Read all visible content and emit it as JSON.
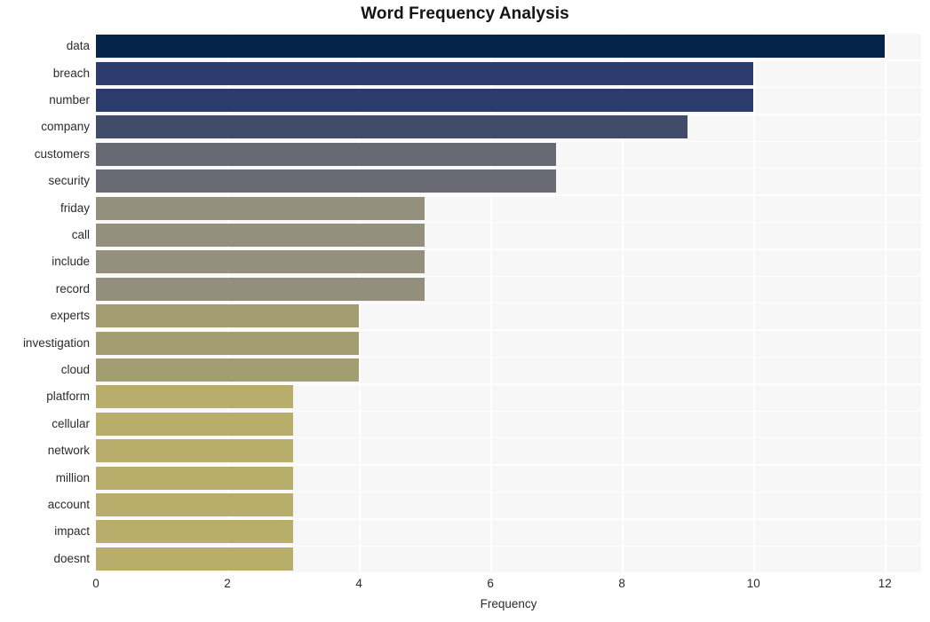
{
  "chart_data": {
    "type": "bar",
    "orientation": "horizontal",
    "title": "Word Frequency Analysis",
    "xlabel": "Frequency",
    "ylabel": "",
    "categories": [
      "data",
      "breach",
      "number",
      "company",
      "customers",
      "security",
      "friday",
      "call",
      "include",
      "record",
      "experts",
      "investigation",
      "cloud",
      "platform",
      "cellular",
      "network",
      "million",
      "account",
      "impact",
      "doesnt"
    ],
    "values": [
      12,
      10,
      10,
      9,
      7,
      7,
      5,
      5,
      5,
      5,
      4,
      4,
      4,
      3,
      3,
      3,
      3,
      3,
      3,
      3
    ],
    "bar_colors": [
      "#042449",
      "#2c3d6d",
      "#2b3c6c",
      "#414c6b",
      "#676873",
      "#696a74",
      "#94907d",
      "#94907d",
      "#93907d",
      "#938f7c",
      "#a39e72",
      "#a39e72",
      "#a39e72",
      "#b9ad6c",
      "#b9ad6c",
      "#b9ad6c",
      "#b9ad6c",
      "#b9ad6c",
      "#b9ad6c",
      "#b9ad6c"
    ],
    "xlim": [
      0,
      12.55
    ],
    "xticks": [
      0,
      2,
      4,
      6,
      8,
      10,
      12
    ],
    "xtick_labels": [
      "0",
      "2",
      "4",
      "6",
      "8",
      "10",
      "12"
    ],
    "grid": true,
    "grid_color": "#ffffff",
    "plot_background": "#f7f7f7",
    "figure_background": "#ffffff",
    "legend": null
  }
}
